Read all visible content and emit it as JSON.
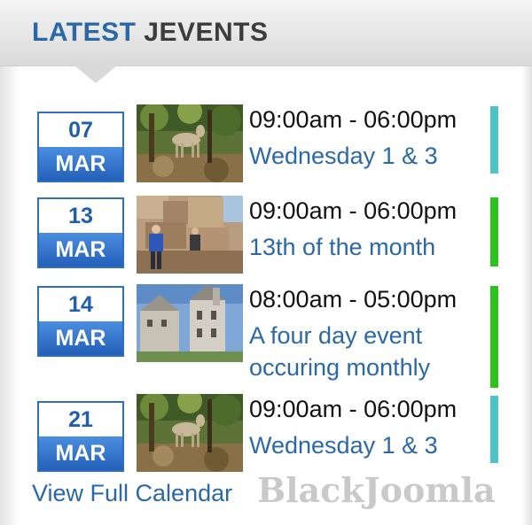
{
  "module": {
    "title_accent": "LATEST",
    "title_rest": "JEVENTS"
  },
  "events": [
    {
      "day": "07",
      "month": "MAR",
      "time": "09:00am - 06:00pm",
      "title": "Wednesday 1 & 3",
      "category_color": "#4fc4c8",
      "image": "deer-in-forest-photo"
    },
    {
      "day": "13",
      "month": "MAR",
      "time": "09:00am - 06:00pm",
      "title": "13th of the month",
      "category_color": "#2ec21e",
      "image": "climbers-on-rocks-photo"
    },
    {
      "day": "14",
      "month": "MAR",
      "time": "08:00am - 05:00pm",
      "title": "A four day event occuring monthly",
      "category_color": "#2ec21e",
      "image": "castle-photo"
    },
    {
      "day": "21",
      "month": "MAR",
      "time": "09:00am - 06:00pm",
      "title": "Wednesday 1 & 3",
      "category_color": "#4fc4c8",
      "image": "deer-in-forest-photo"
    }
  ],
  "footer": {
    "view_calendar_label": "View Full Calendar",
    "watermark": "BlackJoomla"
  }
}
